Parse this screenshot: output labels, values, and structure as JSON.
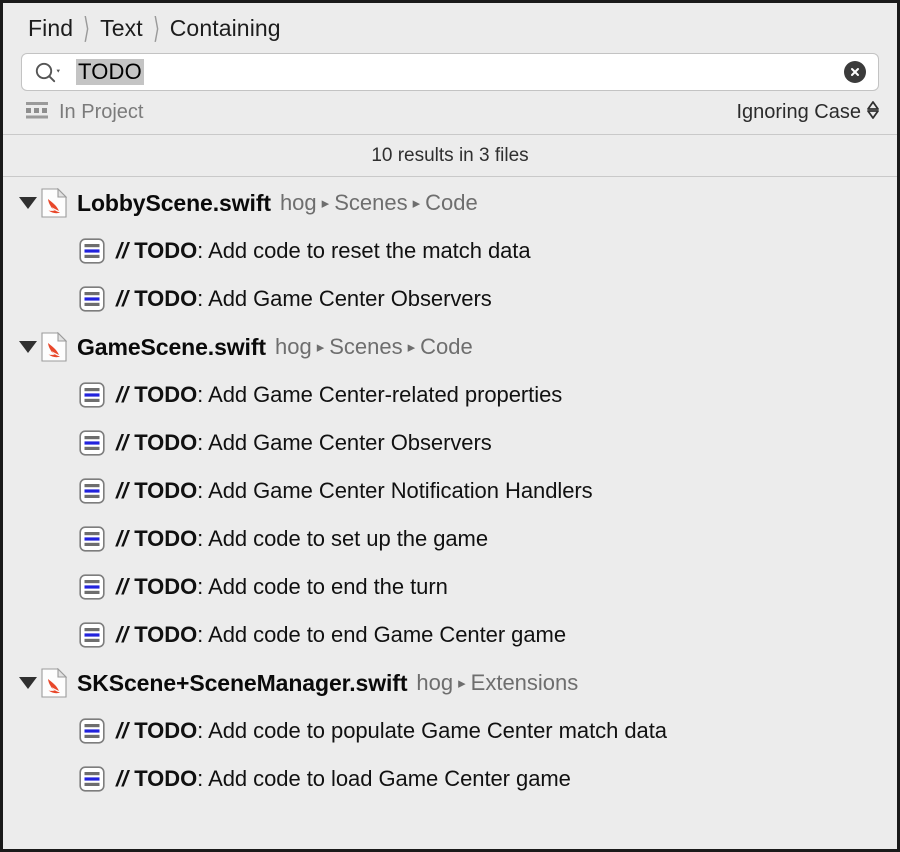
{
  "breadcrumb": {
    "items": [
      "Find",
      "Text",
      "Containing"
    ],
    "separator": "〉"
  },
  "search": {
    "icon": "search-icon",
    "dropdown_icon": "chevron-down-icon",
    "value": "TODO",
    "placeholder": "Search",
    "clear_icon": "close-circle-icon"
  },
  "scope": {
    "icon": "project-scope-icon",
    "label": "In Project",
    "case_option": "Ignoring Case",
    "stepper_icon": "chevron-up-down-icon"
  },
  "results": {
    "count_text": "10 results in 3 files",
    "total_results": 10,
    "total_files": 3,
    "groups": [
      {
        "file_name": "LobbyScene.swift",
        "file_icon": "swift-file-icon",
        "disclosure_icon": "disclosure-triangle-open-icon",
        "path": [
          "hog",
          "Scenes",
          "Code"
        ],
        "matches": [
          {
            "icon": "code-line-icon",
            "prefix": "//",
            "keyword": "TODO",
            "text": ": Add code to reset the match data"
          },
          {
            "icon": "code-line-icon",
            "prefix": "//",
            "keyword": "TODO",
            "text": ": Add Game Center Observers"
          }
        ]
      },
      {
        "file_name": "GameScene.swift",
        "file_icon": "swift-file-icon",
        "disclosure_icon": "disclosure-triangle-open-icon",
        "path": [
          "hog",
          "Scenes",
          "Code"
        ],
        "matches": [
          {
            "icon": "code-line-icon",
            "prefix": "//",
            "keyword": "TODO",
            "text": ": Add Game Center-related properties"
          },
          {
            "icon": "code-line-icon",
            "prefix": "//",
            "keyword": "TODO",
            "text": ": Add Game Center Observers"
          },
          {
            "icon": "code-line-icon",
            "prefix": "//",
            "keyword": "TODO",
            "text": ": Add Game Center Notification Handlers"
          },
          {
            "icon": "code-line-icon",
            "prefix": "//",
            "keyword": "TODO",
            "text": ": Add code to set up the game"
          },
          {
            "icon": "code-line-icon",
            "prefix": "//",
            "keyword": "TODO",
            "text": ": Add code to end the turn"
          },
          {
            "icon": "code-line-icon",
            "prefix": "//",
            "keyword": "TODO",
            "text": ": Add code to end Game Center game"
          }
        ]
      },
      {
        "file_name": "SKScene+SceneManager.swift",
        "file_icon": "swift-file-icon",
        "disclosure_icon": "disclosure-triangle-open-icon",
        "path": [
          "hog",
          "Extensions"
        ],
        "matches": [
          {
            "icon": "code-line-icon",
            "prefix": "//",
            "keyword": "TODO",
            "text": ": Add code to populate Game Center match data"
          },
          {
            "icon": "code-line-icon",
            "prefix": "//",
            "keyword": "TODO",
            "text": ": Add code to load Game Center game"
          }
        ]
      }
    ]
  },
  "colors": {
    "panel_bg": "#ececec",
    "field_bg": "#ffffff",
    "selection_highlight": "#c4c4c4",
    "path_text": "#6e6e6e",
    "accent_blue": "#2222dd",
    "swift_orange": "#e8472a",
    "clear_button": "#3b3b3b"
  }
}
